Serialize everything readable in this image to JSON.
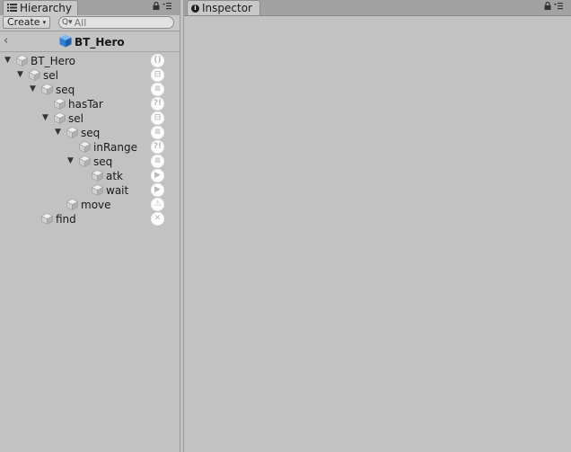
{
  "hierarchy": {
    "tab_label": "Hierarchy",
    "create_label": "Create",
    "search_placeholder": "All",
    "tree_title": "BT_Hero",
    "nodes": [
      {
        "label": "BT_Hero",
        "badge": "()",
        "expanded": true
      },
      {
        "label": "sel",
        "badge": "⊟",
        "expanded": true
      },
      {
        "label": "seq",
        "badge": "≡",
        "expanded": true
      },
      {
        "label": "hasTar",
        "badge": "?!"
      },
      {
        "label": "sel",
        "badge": "⊟",
        "expanded": true
      },
      {
        "label": "seq",
        "badge": "≡",
        "expanded": true
      },
      {
        "label": "inRange",
        "badge": "?!"
      },
      {
        "label": "seq",
        "badge": "≡",
        "expanded": true
      },
      {
        "label": "atk",
        "badge": "▶"
      },
      {
        "label": "wait",
        "badge": "▶"
      },
      {
        "label": "move",
        "badge": "⚠"
      },
      {
        "label": "find",
        "badge": "✕"
      }
    ]
  },
  "inspector": {
    "tab_label": "Inspector"
  },
  "colors": {
    "panel_bg": "#c2c2c2",
    "badge_bg": "#ffffff",
    "cube_icon": "#2f7fd6"
  },
  "icons": {
    "hierarchy_tab": "list-icon",
    "inspector_tab": "info-icon",
    "lock": "lock-icon",
    "menu": "menu-icon",
    "back": "chevron-left-icon",
    "node": "cube-icon"
  }
}
